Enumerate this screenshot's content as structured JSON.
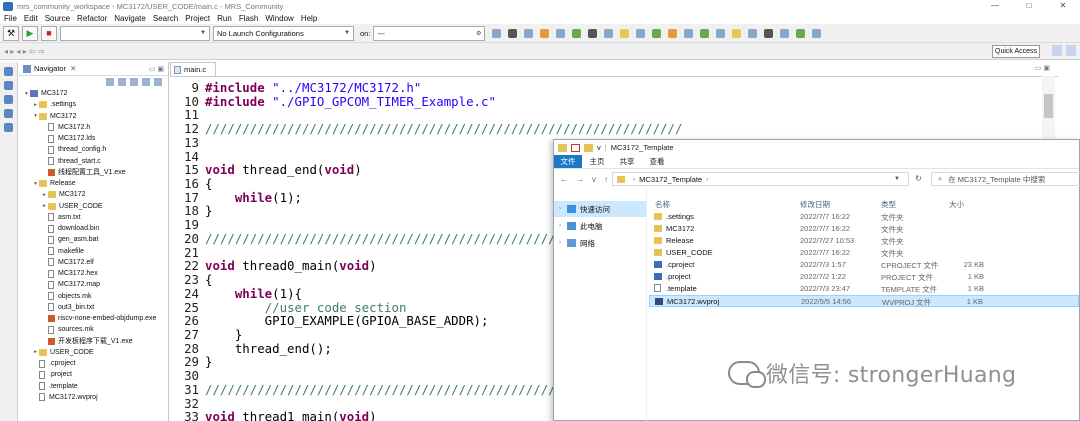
{
  "window": {
    "title": "mrs_community_workspace - MC3172/USER_CODE/main.c - MRS_Community",
    "controls": [
      "—",
      "□",
      "✕"
    ]
  },
  "menu": [
    "File",
    "Edit",
    "Source",
    "Refactor",
    "Navigate",
    "Search",
    "Project",
    "Run",
    "Flash",
    "Window",
    "Help"
  ],
  "toolbar": {
    "launch_mode": "",
    "launch_config": "No Launch Configurations",
    "on_label": "on:",
    "launch_target": "---",
    "quick_access": "Quick Access"
  },
  "navigator": {
    "tab_label": "Navigator",
    "tree": [
      {
        "label": "MC3172",
        "type": "project",
        "depth": 0,
        "twisty": "v"
      },
      {
        "label": ".settings",
        "type": "folder",
        "depth": 1,
        "twisty": ">"
      },
      {
        "label": "MC3172",
        "type": "folder",
        "depth": 1,
        "twisty": "v"
      },
      {
        "label": "MC3172.h",
        "type": "file",
        "depth": 2,
        "twisty": ""
      },
      {
        "label": "MC3172.lds",
        "type": "file",
        "depth": 2,
        "twisty": ""
      },
      {
        "label": "thread_config.h",
        "type": "file",
        "depth": 2,
        "twisty": ""
      },
      {
        "label": "thread_start.c",
        "type": "file",
        "depth": 2,
        "twisty": ""
      },
      {
        "label": "线程配置工具_V1.exe",
        "type": "exe",
        "depth": 2,
        "twisty": ""
      },
      {
        "label": "Release",
        "type": "folder",
        "depth": 1,
        "twisty": "v"
      },
      {
        "label": "MC3172",
        "type": "folder",
        "depth": 2,
        "twisty": ">"
      },
      {
        "label": "USER_CODE",
        "type": "folder",
        "depth": 2,
        "twisty": ">"
      },
      {
        "label": "asm.txt",
        "type": "file",
        "depth": 2,
        "twisty": ""
      },
      {
        "label": "download.bin",
        "type": "file",
        "depth": 2,
        "twisty": ""
      },
      {
        "label": "gen_asm.bat",
        "type": "file",
        "depth": 2,
        "twisty": ""
      },
      {
        "label": "makefile",
        "type": "file",
        "depth": 2,
        "twisty": ""
      },
      {
        "label": "MC3172.elf",
        "type": "file",
        "depth": 2,
        "twisty": ""
      },
      {
        "label": "MC3172.hex",
        "type": "file",
        "depth": 2,
        "twisty": ""
      },
      {
        "label": "MC3172.map",
        "type": "file",
        "depth": 2,
        "twisty": ""
      },
      {
        "label": "objects.mk",
        "type": "file",
        "depth": 2,
        "twisty": ""
      },
      {
        "label": "out3_bin.txt",
        "type": "file",
        "depth": 2,
        "twisty": ""
      },
      {
        "label": "riscv-none-embed-objdump.exe",
        "type": "exe",
        "depth": 2,
        "twisty": ""
      },
      {
        "label": "sources.mk",
        "type": "file",
        "depth": 2,
        "twisty": ""
      },
      {
        "label": "开发板程序下载_V1.exe",
        "type": "exe",
        "depth": 2,
        "twisty": ""
      },
      {
        "label": "USER_CODE",
        "type": "folder",
        "depth": 1,
        "twisty": ">"
      },
      {
        "label": ".cproject",
        "type": "file",
        "depth": 1,
        "twisty": ""
      },
      {
        "label": ".project",
        "type": "file",
        "depth": 1,
        "twisty": ""
      },
      {
        "label": ".template",
        "type": "file",
        "depth": 1,
        "twisty": ""
      },
      {
        "label": "MC3172.wvproj",
        "type": "file",
        "depth": 1,
        "twisty": ""
      }
    ]
  },
  "editor": {
    "tab_label": "main.c",
    "lines": [
      {
        "n": "9",
        "parts": [
          [
            "kw",
            "#include "
          ],
          [
            "str",
            "\"../MC3172/MC3172.h\""
          ]
        ]
      },
      {
        "n": "10",
        "parts": [
          [
            "kw",
            "#include "
          ],
          [
            "str",
            "\"./GPIO_GPCOM_TIMER_Example.c\""
          ]
        ]
      },
      {
        "n": "11",
        "parts": []
      },
      {
        "n": "12",
        "parts": [
          [
            "cmt",
            "////////////////////////////////////////////////////////////////"
          ]
        ]
      },
      {
        "n": "13",
        "parts": []
      },
      {
        "n": "14",
        "parts": []
      },
      {
        "n": "15",
        "parts": [
          [
            "kw",
            "void"
          ],
          [
            "",
            " thread_end("
          ],
          [
            "kw",
            "void"
          ],
          [
            "",
            ")"
          ]
        ]
      },
      {
        "n": "16",
        "parts": [
          [
            "",
            "{"
          ]
        ]
      },
      {
        "n": "17",
        "parts": [
          [
            "",
            "    "
          ],
          [
            "kw",
            "while"
          ],
          [
            "",
            "(1);"
          ]
        ]
      },
      {
        "n": "18",
        "parts": [
          [
            "",
            "}"
          ]
        ]
      },
      {
        "n": "19",
        "parts": []
      },
      {
        "n": "20",
        "parts": [
          [
            "cmt",
            "////////////////////////////////////////////////////////////////////////"
          ]
        ]
      },
      {
        "n": "21",
        "parts": []
      },
      {
        "n": "22",
        "parts": [
          [
            "kw",
            "void"
          ],
          [
            "",
            " thread0_main("
          ],
          [
            "kw",
            "void"
          ],
          [
            "",
            ")"
          ]
        ]
      },
      {
        "n": "23",
        "parts": [
          [
            "",
            "{"
          ]
        ]
      },
      {
        "n": "24",
        "parts": [
          [
            "",
            "    "
          ],
          [
            "kw",
            "while"
          ],
          [
            "",
            "(1){"
          ]
        ]
      },
      {
        "n": "25",
        "parts": [
          [
            "",
            "        "
          ],
          [
            "cmt",
            "//user code section"
          ]
        ]
      },
      {
        "n": "26",
        "parts": [
          [
            "",
            "        GPIO_EXAMPLE(GPIOA_BASE_ADDR);"
          ]
        ]
      },
      {
        "n": "27",
        "parts": [
          [
            "",
            "    }"
          ]
        ]
      },
      {
        "n": "28",
        "parts": [
          [
            "",
            "    thread_end();"
          ]
        ]
      },
      {
        "n": "29",
        "parts": [
          [
            "",
            "}"
          ]
        ]
      },
      {
        "n": "30",
        "parts": []
      },
      {
        "n": "31",
        "parts": [
          [
            "cmt",
            "////////////////////////////////////////////////////////////////////////"
          ]
        ]
      },
      {
        "n": "32",
        "parts": []
      },
      {
        "n": "33",
        "parts": [
          [
            "kw",
            "void"
          ],
          [
            "",
            " thread1_main("
          ],
          [
            "kw",
            "void"
          ],
          [
            "",
            ")"
          ]
        ]
      },
      {
        "n": "34",
        "parts": [
          [
            "",
            "{"
          ]
        ]
      }
    ]
  },
  "explorer": {
    "title": "MC3172_Template",
    "title_sep": "|",
    "title_v": "v",
    "ribbon_tabs": {
      "file": "文件",
      "home": "主页",
      "share": "共享",
      "view": "查看"
    },
    "nav": {
      "back": "←",
      "forward": "→",
      "recent": "v",
      "up": "↑"
    },
    "address": "MC3172_Template",
    "search_placeholder": "在 MC3172_Template 中搜索",
    "sidebar": [
      {
        "label": "快速访问",
        "icon": "star-icon",
        "selected": true
      },
      {
        "label": "此电脑",
        "icon": "pc-icon",
        "selected": false
      },
      {
        "label": "网络",
        "icon": "network-icon",
        "selected": false
      }
    ],
    "columns": {
      "name": "名称",
      "date": "修改日期",
      "type": "类型",
      "size": "大小"
    },
    "files": [
      {
        "name": ".settings",
        "date": "2022/7/7 16:22",
        "type": "文件夹",
        "size": "",
        "icon": "folder"
      },
      {
        "name": "MC3172",
        "date": "2022/7/7 16:22",
        "type": "文件夹",
        "size": "",
        "icon": "folder"
      },
      {
        "name": "Release",
        "date": "2022/7/27 10:53",
        "type": "文件夹",
        "size": "",
        "icon": "folder"
      },
      {
        "name": "USER_CODE",
        "date": "2022/7/7 16:22",
        "type": "文件夹",
        "size": "",
        "icon": "folder"
      },
      {
        "name": ".cproject",
        "date": "2022/7/3 1:57",
        "type": "CPROJECT 文件",
        "size": "23 KB",
        "icon": "cfg"
      },
      {
        "name": ".project",
        "date": "2022/7/2 1:22",
        "type": "PROJECT 文件",
        "size": "1 KB",
        "icon": "cfg"
      },
      {
        "name": ".template",
        "date": "2022/7/3 23:47",
        "type": "TEMPLATE 文件",
        "size": "1 KB",
        "icon": "doc"
      },
      {
        "name": "MC3172.wvproj",
        "date": "2022/5/5 14:56",
        "type": "WVPROJ 文件",
        "size": "1 KB",
        "icon": "wvp",
        "selected": true
      }
    ]
  },
  "watermark": "微信号: strongerHuang"
}
